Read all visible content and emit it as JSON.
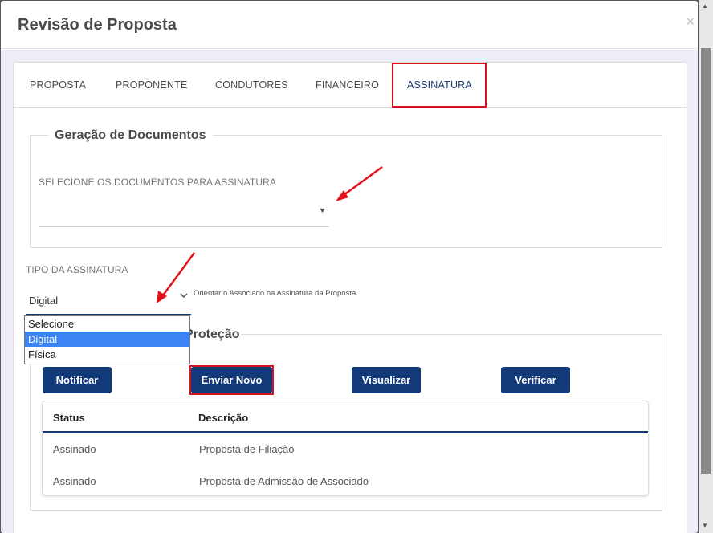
{
  "modal": {
    "title": "Revisão de Proposta",
    "close_symbol": "×"
  },
  "tabs": [
    {
      "label": "PROPOSTA"
    },
    {
      "label": "PROPONENTE"
    },
    {
      "label": "CONDUTORES"
    },
    {
      "label": "FINANCEIRO"
    },
    {
      "label": "ASSINATURA",
      "active": true
    }
  ],
  "document_generation": {
    "legend": "Geração de Documentos",
    "select_label": "SELECIONE OS DOCUMENTOS PARA ASSINATURA",
    "selected_value": ""
  },
  "signature_type": {
    "label": "TIPO DA ASSINATURA",
    "selected_value": "Digital",
    "hint": "Orientar o Associado na Assinatura da Proposta.",
    "options": [
      "Selecione",
      "Digital",
      "Física"
    ]
  },
  "protection": {
    "legend_visible_part": "Proteção"
  },
  "buttons": {
    "notify": "Notificar",
    "send_new": "Enviar Novo",
    "view": "Visualizar",
    "verify": "Verificar"
  },
  "table": {
    "columns": [
      "Status",
      "Descrição"
    ],
    "rows": [
      {
        "status": "Assinado",
        "description": "Proposta de Filiação"
      },
      {
        "status": "Assinado",
        "description": "Proposta de Admissão de Associado"
      }
    ]
  },
  "colors": {
    "primary": "#133a78",
    "highlight": "#d9111f",
    "dropdown_selected": "#3b84f4"
  },
  "icons": {
    "close": "close-icon",
    "caret": "caret-down-icon",
    "chevron": "chevron-down-icon"
  }
}
